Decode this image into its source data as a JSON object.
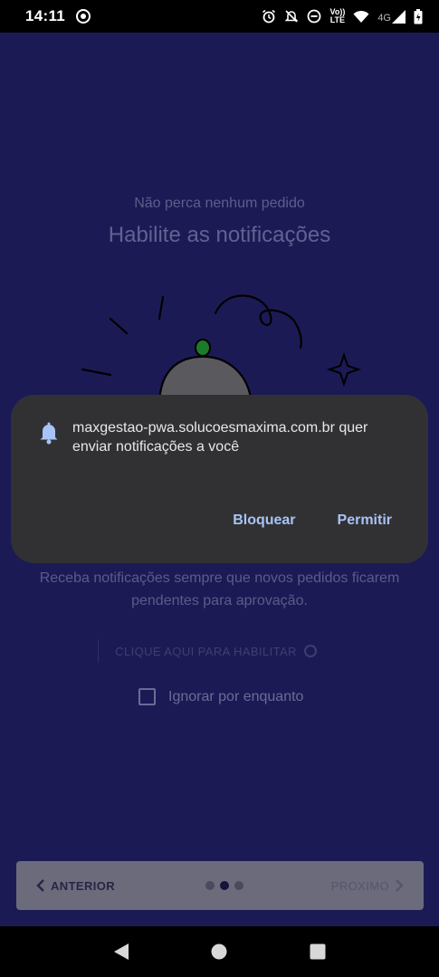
{
  "status_bar": {
    "time": "14:11",
    "volte_line1": "Vo))",
    "volte_line2": "LTE",
    "network": "4G",
    "icons": [
      "record-icon",
      "alarm-icon",
      "bell-off-icon",
      "do-not-disturb-icon",
      "volte-icon",
      "wifi-icon",
      "signal-icon",
      "battery-icon"
    ]
  },
  "page": {
    "subtitle": "Não perca nenhum pedido",
    "title": "Habilite as notificações",
    "description": "Receba notificações sempre que novos pedidos ficarem pendentes para aprovação.",
    "enable_button": "CLIQUE AQUI PARA HABILITAR",
    "ignore_label": "Ignorar por enquanto"
  },
  "pager": {
    "prev_label": "ANTERIOR",
    "next_label": "PROXIMO",
    "page_count": 3,
    "active_index": 1
  },
  "dialog": {
    "message": "maxgestao-pwa.solucoesmaxima.com.br quer enviar notificações a você",
    "block_label": "Bloquear",
    "allow_label": "Permitir",
    "icon": "bell-icon"
  },
  "system_nav": [
    "back-icon",
    "home-icon",
    "recents-icon"
  ],
  "colors": {
    "background": "#1c1a55",
    "dialog_bg": "#313134",
    "dialog_button": "#a8c3f5"
  }
}
